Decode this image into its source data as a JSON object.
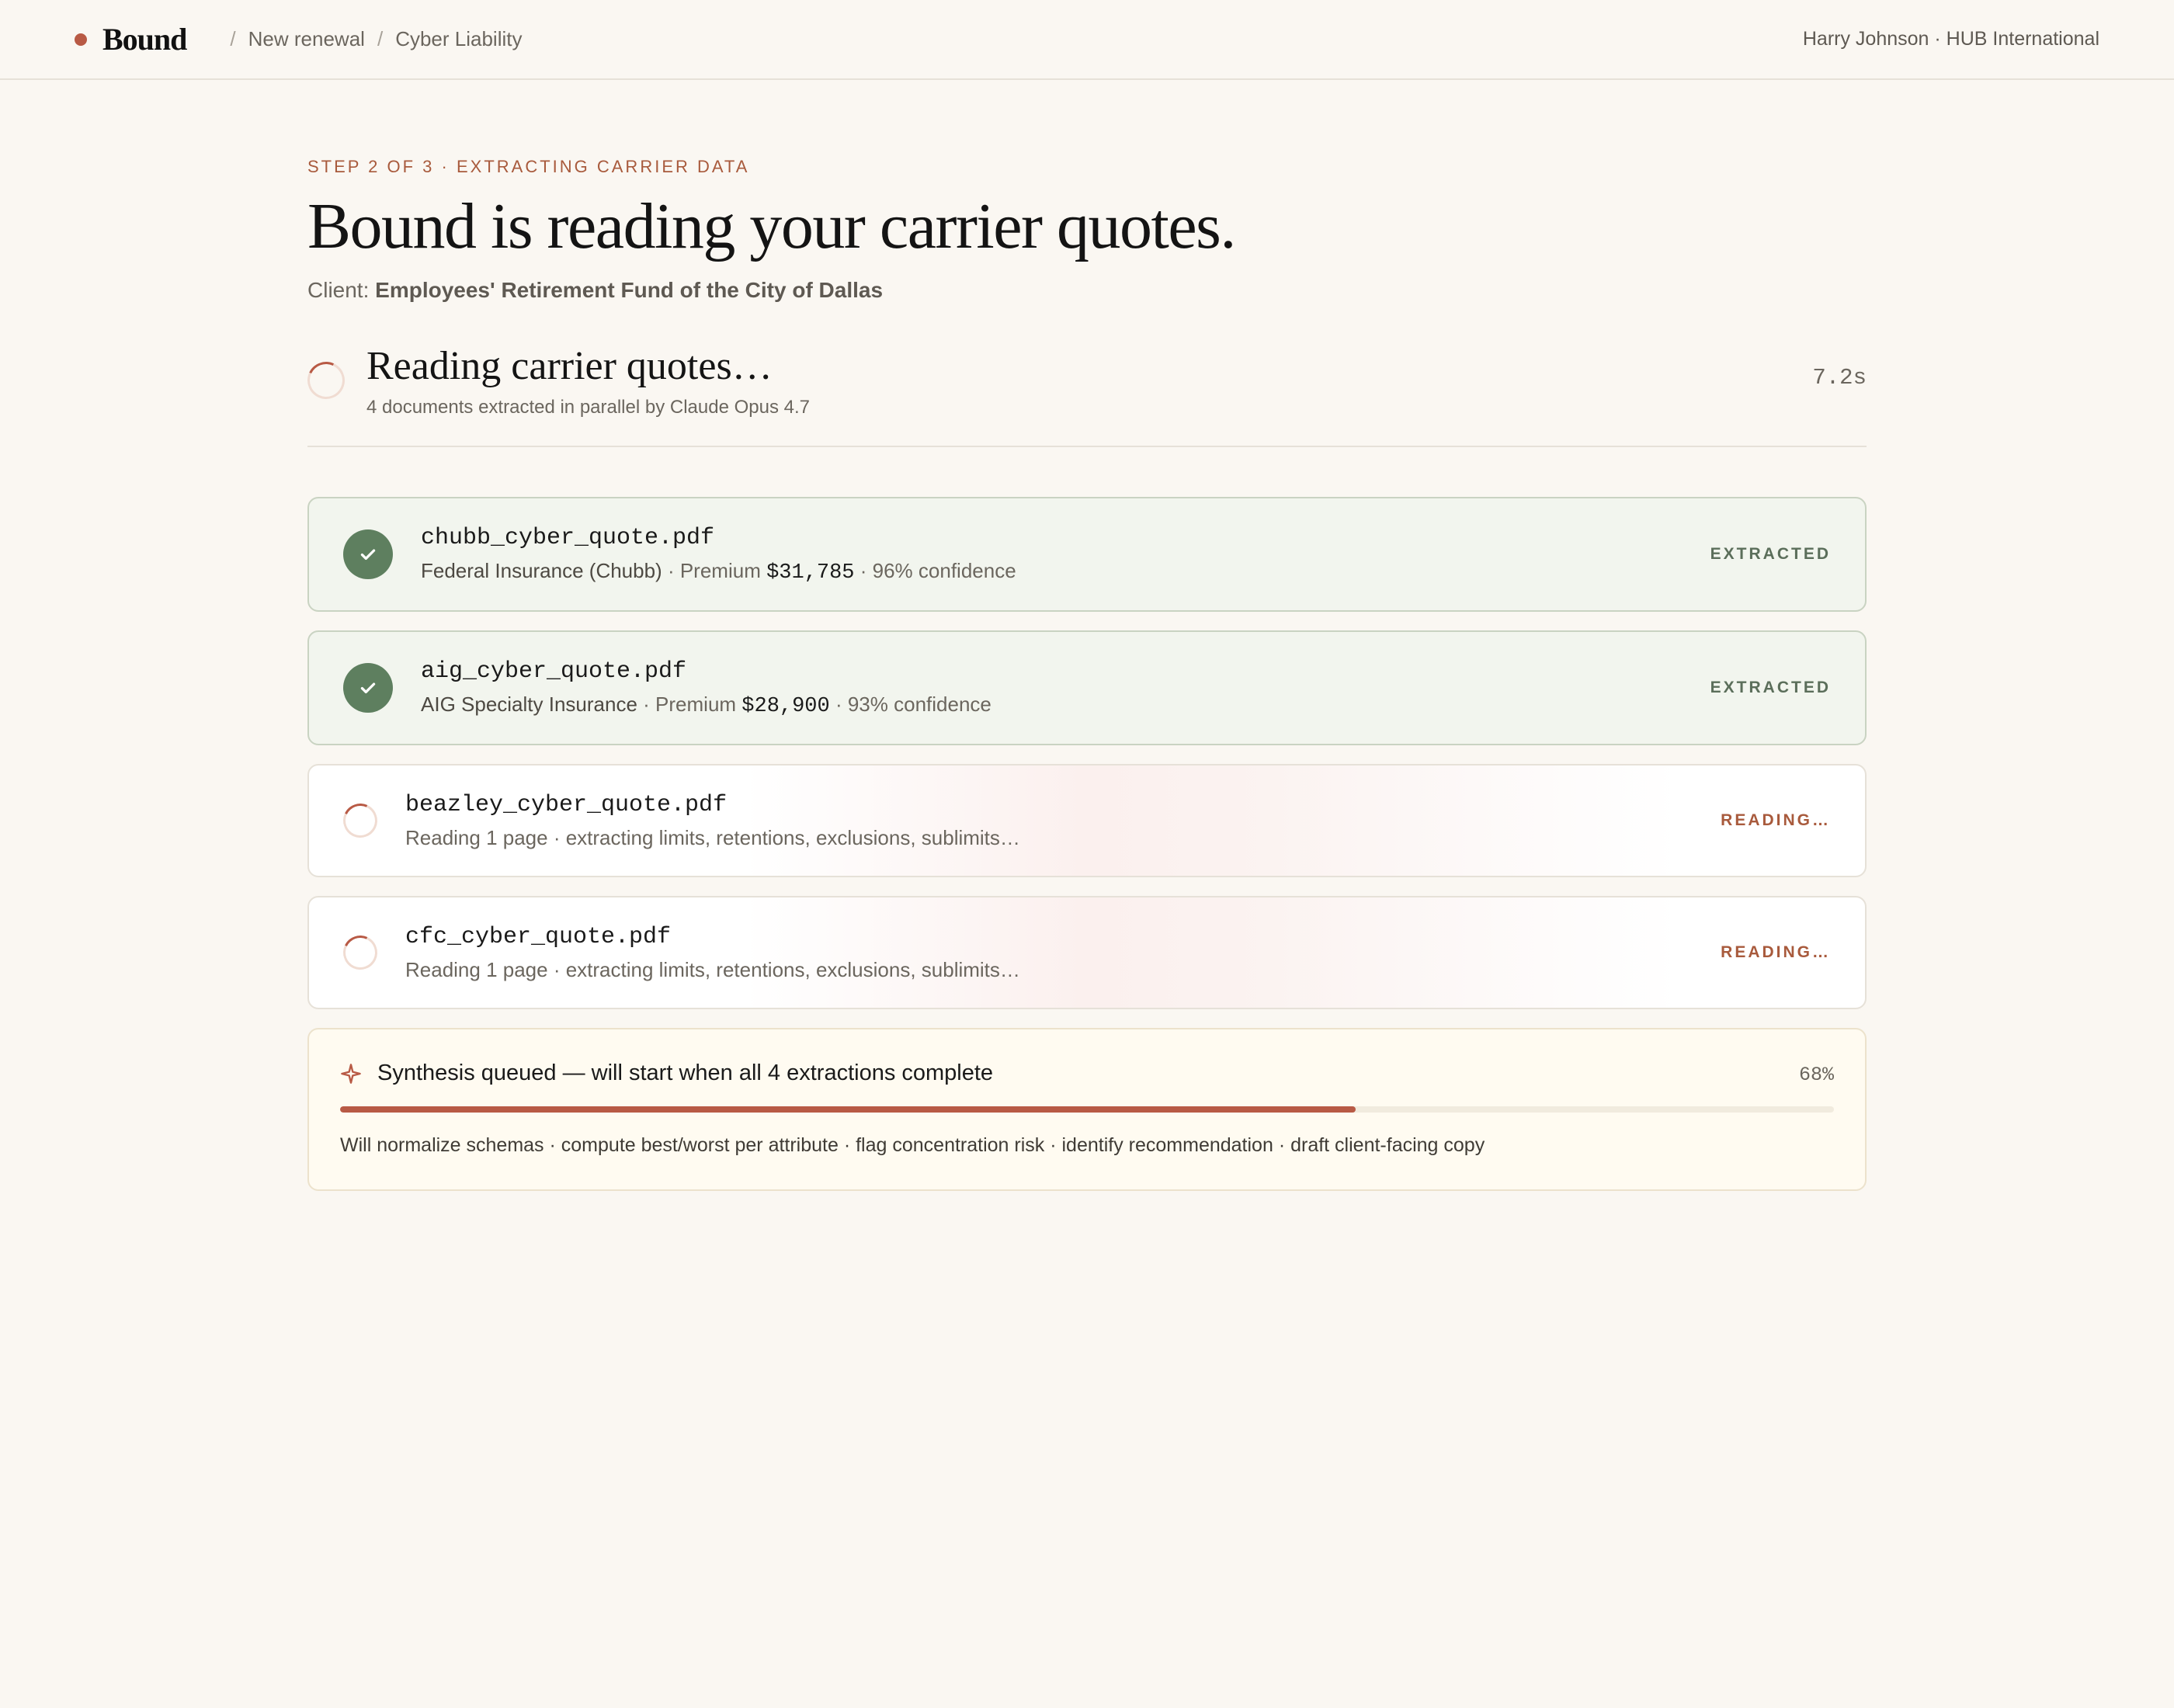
{
  "header": {
    "brand": "Bound",
    "breadcrumbs": [
      "New renewal",
      "Cyber Liability"
    ],
    "user": "Harry Johnson · HUB International"
  },
  "page": {
    "step": "STEP 2 OF 3 · EXTRACTING CARRIER DATA",
    "headline": "Bound is reading your carrier quotes.",
    "client_label": "Client:",
    "client_name": "Employees' Retirement Fund of the City of Dallas"
  },
  "status": {
    "title": "Reading carrier quotes…",
    "subtitle": "4 documents extracted in parallel by Claude Opus 4.7",
    "elapsed": "7.2s"
  },
  "documents": [
    {
      "filename": "chubb_cyber_quote.pdf",
      "carrier": "Federal Insurance (Chubb)",
      "premium_label": "Premium",
      "premium": "$31,785",
      "confidence": "96% confidence",
      "status": "EXTRACTED"
    },
    {
      "filename": "aig_cyber_quote.pdf",
      "carrier": "AIG Specialty Insurance",
      "premium_label": "Premium",
      "premium": "$28,900",
      "confidence": "93% confidence",
      "status": "EXTRACTED"
    },
    {
      "filename": "beazley_cyber_quote.pdf",
      "detail": "Reading 1 page · extracting limits, retentions, exclusions, sublimits…",
      "status": "READING…"
    },
    {
      "filename": "cfc_cyber_quote.pdf",
      "detail": "Reading 1 page · extracting limits, retentions, exclusions, sublimits…",
      "status": "READING…"
    }
  ],
  "synthesis": {
    "icon": "sparkle-icon",
    "title": "Synthesis queued — will start when all 4 extractions complete",
    "percent_label": "68%",
    "progress": 0.68,
    "description": "Will normalize schemas · compute best/worst per attribute · flag concentration risk · identify recommendation · draft client-facing copy"
  },
  "colors": {
    "accent": "#b85a45",
    "success": "#5e7f5f",
    "background": "#faf7f2"
  }
}
